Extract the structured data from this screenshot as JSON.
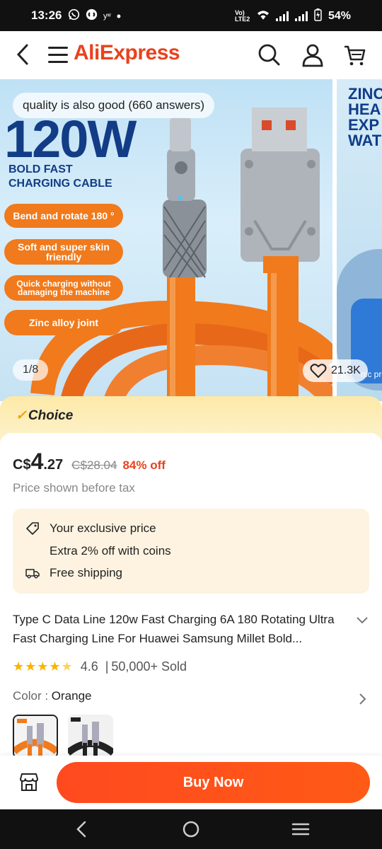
{
  "status_bar": {
    "time": "13:26",
    "network": "Vo) LTE2",
    "battery": "54%",
    "misc": "yʷ"
  },
  "nav": {
    "logo": "AliExpress",
    "icons": [
      "back-icon",
      "menu-icon",
      "search-icon",
      "account-icon",
      "cart-icon"
    ]
  },
  "gallery": {
    "qa_chip": "quality is also good (660 answers)",
    "headline": "120W",
    "subhead_line1": "BOLD FAST",
    "subhead_line2": "CHARGING CABLE",
    "features": [
      "Bend and rotate 180 °",
      "Soft and super skin friendly",
      "Quick charging without damaging the machine",
      "Zinc alloy joint"
    ],
    "counter": "1/8",
    "likes": "21.3K",
    "next_panel_text": "ZINC\nHEA\nEXP\nWAT",
    "next_panel_caption": "nic prote Mo"
  },
  "choice": {
    "label": "Choice"
  },
  "price": {
    "currency": "C$",
    "integer": "4",
    "decimal": ".27",
    "original": "C$28.04",
    "discount": "84% off",
    "tax_note": "Price shown before tax"
  },
  "promo": {
    "exclusive": "Your exclusive price",
    "coins": "Extra 2% off with coins",
    "shipping": "Free shipping"
  },
  "product": {
    "title": "Type C Data Line 120w Fast Charging 6A 180 Rotating Ultra Fast Charging Line For Huawei Samsung Millet Bold...",
    "rating": "4.6",
    "sold": "50,000+ Sold",
    "separator": "|",
    "color_label": "Color",
    "color_value": "Orange"
  },
  "actions": {
    "buy_now": "Buy Now"
  },
  "colors": {
    "brand": "#e8421d",
    "buy_button": "#ff4a1f",
    "choice_gold": "#f4a300",
    "stars": "#f7b500",
    "promo_bg": "#fdf3e0"
  }
}
